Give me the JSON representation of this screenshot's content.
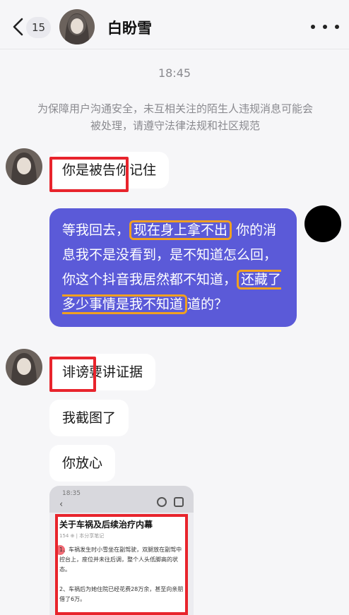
{
  "header": {
    "back_icon": "chevron-left-icon",
    "unread_count": "15",
    "contact_name": "白盼雪",
    "more_icon": "more-dots-icon"
  },
  "chat": {
    "timestamp": "18:45",
    "notice": "为保障用户沟通安全，未互相关注的陌生人违规消息可能会被处理，请遵守法律法规和社区规范"
  },
  "messages": [
    {
      "sender": "other",
      "text": "你是被告你记住"
    },
    {
      "sender": "me",
      "parts": [
        "等我回去，",
        "现在身上拿不出",
        " 你的消息我不是没看到，是不知道怎么回，你这个抖音我居然都不知道，",
        "还藏了多少事情是我不知道",
        "道的？"
      ]
    },
    {
      "sender": "other",
      "text": "诽谤要讲证据"
    },
    {
      "sender": "other",
      "text": "我截图了"
    },
    {
      "sender": "other",
      "text": "你放心"
    }
  ],
  "screenshot_attachment": {
    "status_time": "18:35",
    "article_title": "关于车祸及后续治疗内幕",
    "meta": "154 ⊕ | 本分享笔记",
    "paragraph_1": "1、车祸发生时小雪坐在副驾驶，双腿放在副驾中控台上，座位并未往后调，整个人头低脚高的状态。",
    "paragraph_2": "2、车祸后为她住院已经花费28万余，甚至向亲朋借了6万。"
  },
  "colors": {
    "my_bubble": "#5b5ad8",
    "highlight_red": "#e8242c",
    "highlight_yellow": "#f0a020",
    "background": "#f6f6f8"
  }
}
